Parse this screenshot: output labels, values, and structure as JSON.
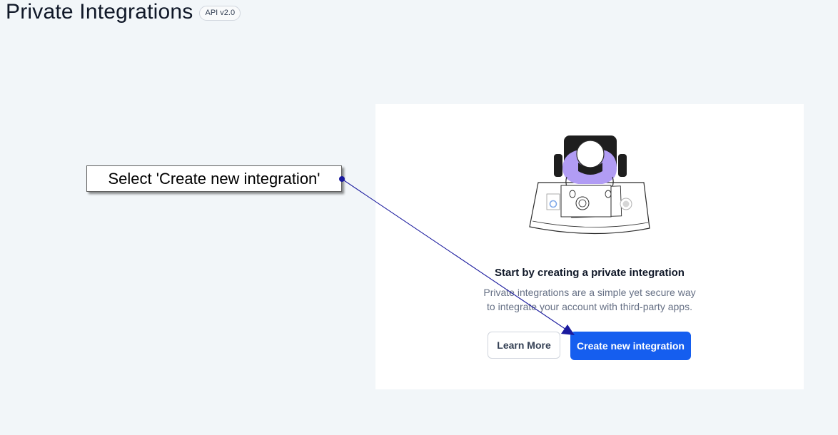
{
  "header": {
    "title": "Private Integrations",
    "badge": "API v2.0"
  },
  "empty_state": {
    "title": "Start by creating a private integration",
    "description_line1": "Private integrations are a simple yet secure way",
    "description_line2": "to integrate your account with third-party apps.",
    "illustration": "person-at-desk-illustration",
    "learn_more_label": "Learn More",
    "create_label": "Create new integration"
  },
  "annotation": {
    "callout_text": "Select 'Create new integration'",
    "arrow_color": "#1a1a9e"
  },
  "colors": {
    "background": "#f2f6f9",
    "primary": "#155eef",
    "card": "#ffffff",
    "illustration_accent": "#b19cf4"
  }
}
